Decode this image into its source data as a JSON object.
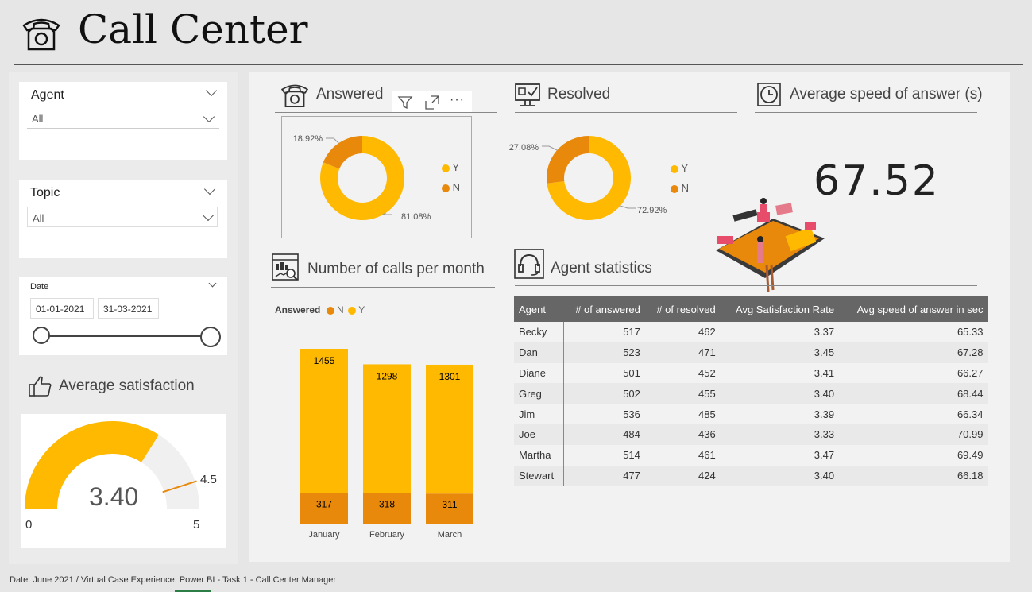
{
  "header": {
    "title": "Call Center",
    "icon": "telephone-icon"
  },
  "slicers": {
    "agent": {
      "label": "Agent",
      "value": "All"
    },
    "topic": {
      "label": "Topic",
      "value": "All"
    },
    "date": {
      "label": "Date",
      "start": "01-01-2021",
      "end": "31-03-2021"
    }
  },
  "avg_satisfaction": {
    "title": "Average satisfaction",
    "value": "3.40",
    "min": "0",
    "max": "5",
    "target": "4.5",
    "value_num": 3.4,
    "max_num": 5,
    "target_num": 4.5
  },
  "answered": {
    "title": "Answered",
    "legend": [
      "Y",
      "N"
    ],
    "chart_data": {
      "type": "pie",
      "categories": [
        "Y",
        "N"
      ],
      "values": [
        81.08,
        18.92
      ],
      "labels": [
        "81.08%",
        "18.92%"
      ]
    },
    "toolbar": {
      "filter": "filter-icon",
      "focus": "focus-mode-icon",
      "more": "···"
    }
  },
  "resolved": {
    "title": "Resolved",
    "legend": [
      "Y",
      "N"
    ],
    "chart_data": {
      "type": "pie",
      "categories": [
        "Y",
        "N"
      ],
      "values": [
        72.92,
        27.08
      ],
      "labels": [
        "72.92%",
        "27.08%"
      ]
    }
  },
  "speed": {
    "title": "Average speed of answer (s)",
    "value": "67.52"
  },
  "calls_month": {
    "title": "Number of calls per month",
    "legend_title": "Answered",
    "legend": [
      "N",
      "Y"
    ],
    "chart_data": {
      "type": "bar",
      "categories": [
        "January",
        "February",
        "March"
      ],
      "series": [
        {
          "name": "N",
          "values": [
            317,
            318,
            311
          ]
        },
        {
          "name": "Y",
          "values": [
            1455,
            1298,
            1301
          ]
        }
      ]
    }
  },
  "agent_stats": {
    "title": "Agent statistics",
    "columns": [
      "Agent",
      "# of answered",
      "# of resolved",
      "Avg Satisfaction Rate",
      "Avg speed of answer in sec"
    ],
    "rows": [
      [
        "Becky",
        "517",
        "462",
        "3.37",
        "65.33"
      ],
      [
        "Dan",
        "523",
        "471",
        "3.45",
        "67.28"
      ],
      [
        "Diane",
        "501",
        "452",
        "3.41",
        "66.27"
      ],
      [
        "Greg",
        "502",
        "455",
        "3.40",
        "68.44"
      ],
      [
        "Jim",
        "536",
        "485",
        "3.39",
        "66.34"
      ],
      [
        "Joe",
        "484",
        "436",
        "3.33",
        "70.99"
      ],
      [
        "Martha",
        "514",
        "461",
        "3.47",
        "69.49"
      ],
      [
        "Stewart",
        "477",
        "424",
        "3.40",
        "66.18"
      ]
    ]
  },
  "footer": {
    "text": "Date: June 2021 / Virtual Case Experience: Power BI - Task 1 - Call Center Manager"
  },
  "colors": {
    "yes": "#FFB900",
    "no": "#E8890C",
    "track": "#f0f0f0",
    "header": "#666666"
  }
}
